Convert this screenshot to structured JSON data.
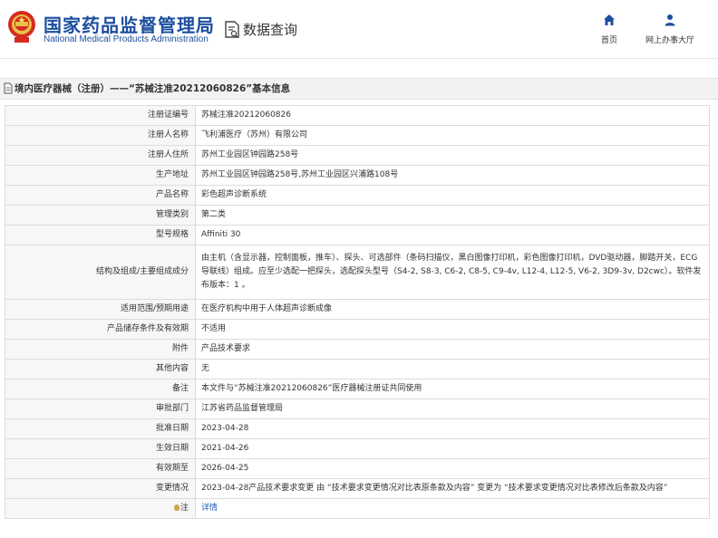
{
  "header": {
    "site_name_cn": "国家药品监督管理局",
    "site_name_en": "National Medical Products Administration",
    "section_title": "数据查询",
    "nav": [
      {
        "label": "首页",
        "icon": "home-icon"
      },
      {
        "label": "网上办事大厅",
        "icon": "user-icon"
      }
    ]
  },
  "page_title": "境内医疗器械（注册）——“苏械注准20212060826”基本信息",
  "rows": [
    {
      "label": "注册证编号",
      "value": "苏械注准20212060826"
    },
    {
      "label": "注册人名称",
      "value": "飞利浦医疗（苏州）有限公司"
    },
    {
      "label": "注册人住所",
      "value": "苏州工业园区钟园路258号"
    },
    {
      "label": "生产地址",
      "value": "苏州工业园区钟园路258号,苏州工业园区兴浦路108号"
    },
    {
      "label": "产品名称",
      "value": "彩色超声诊断系统"
    },
    {
      "label": "管理类别",
      "value": "第二类"
    },
    {
      "label": "型号规格",
      "value": "Affiniti 30"
    },
    {
      "label": "结构及组成/主要组成成分",
      "value": "由主机（含显示器，控制面板，推车）、探头、可选部件（条码扫描仪，黑白图像打印机，彩色图像打印机，DVD驱动器，脚踏开关，ECG导联线）组成。应至少选配一把探头，选配探头型号（S4-2, S8-3, C6-2, C8-5, C9-4v, L12-4, L12-5, V6-2, 3D9-3v, D2cwc）。软件发布版本：1 。"
    },
    {
      "label": "适用范围/预期用途",
      "value": "在医疗机构中用于人体超声诊断成像"
    },
    {
      "label": "产品储存条件及有效期",
      "value": "不适用"
    },
    {
      "label": "附件",
      "value": "产品技术要求"
    },
    {
      "label": "其他内容",
      "value": "无"
    },
    {
      "label": "备注",
      "value": "本文件与“苏械注准20212060826”医疗器械注册证共同使用"
    },
    {
      "label": "审批部门",
      "value": "江苏省药品监督管理局"
    },
    {
      "label": "批准日期",
      "value": "2023-04-28"
    },
    {
      "label": "生效日期",
      "value": "2021-04-26"
    },
    {
      "label": "有效期至",
      "value": "2026-04-25"
    },
    {
      "label": "变更情况",
      "value": "2023-04-28产品技术要求变更 由 “技术要求变更情况对比表原条款及内容” 变更为 “技术要求变更情况对比表修改后条款及内容”"
    },
    {
      "label": "注",
      "value": "详情"
    }
  ],
  "colors": {
    "brand_blue": "#1d4e9e",
    "link_blue": "#1d5fb3"
  }
}
